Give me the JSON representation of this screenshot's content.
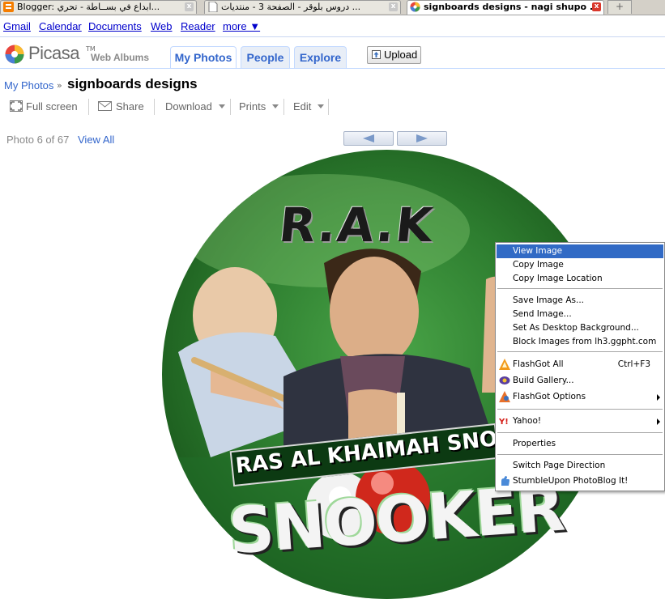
{
  "browser": {
    "tabs": [
      {
        "label": "Blogger: ابداع في بســاطة - تحري...",
        "active": false
      },
      {
        "label": "دروس بلوقر - الصفحة 3 - منتديات ...",
        "active": false
      },
      {
        "label": "signboards designs - nagi shupo ...",
        "active": true
      }
    ]
  },
  "google_bar": {
    "links": [
      "Gmail",
      "Calendar",
      "Documents",
      "Web",
      "Reader",
      "more ▼"
    ]
  },
  "header": {
    "logo_word": "Picasa",
    "logo_tm": "TM",
    "logo_sub": "Web Albums",
    "nav_tabs": [
      "My Photos",
      "People",
      "Explore"
    ],
    "upload_label": "Upload"
  },
  "breadcrumb": {
    "parent": "My Photos",
    "separator": "»",
    "album_title": "signboards designs"
  },
  "toolbar": {
    "fullscreen": "Full screen",
    "share": "Share",
    "download": "Download",
    "prints": "Prints",
    "edit": "Edit"
  },
  "photo_nav": {
    "count": "Photo 6 of 67",
    "view_all": "View All"
  },
  "photo": {
    "title_text": "R.A.K",
    "banner_text": "RAS AL KHAIMAH SNOOKE",
    "big_text": "SNOOKER"
  },
  "context_menu": {
    "items": [
      {
        "label": "View Image",
        "highlighted": true
      },
      {
        "label": "Copy Image"
      },
      {
        "label": "Copy Image Location"
      },
      {
        "label": "Save Image As..."
      },
      {
        "label": "Send Image..."
      },
      {
        "label": "Set As Desktop Background..."
      },
      {
        "label": "Block Images from lh3.ggpht.com"
      },
      {
        "label": "FlashGot All",
        "shortcut": "Ctrl+F3",
        "icon": "flashgot-icon"
      },
      {
        "label": "Build Gallery...",
        "icon": "build-gallery-icon"
      },
      {
        "label": "FlashGot Options",
        "submenu": true,
        "icon": "flashgot-options-icon"
      },
      {
        "label": "Yahoo!",
        "submenu": true,
        "icon": "yahoo-icon"
      },
      {
        "label": "Properties"
      },
      {
        "label": "Switch Page Direction"
      },
      {
        "label": "StumbleUpon PhotoBlog It!",
        "icon": "stumbleupon-icon"
      }
    ]
  },
  "colors": {
    "link": "#0000cc",
    "picasa_blue": "#3366cc",
    "menu_highlight": "#316ac5"
  }
}
